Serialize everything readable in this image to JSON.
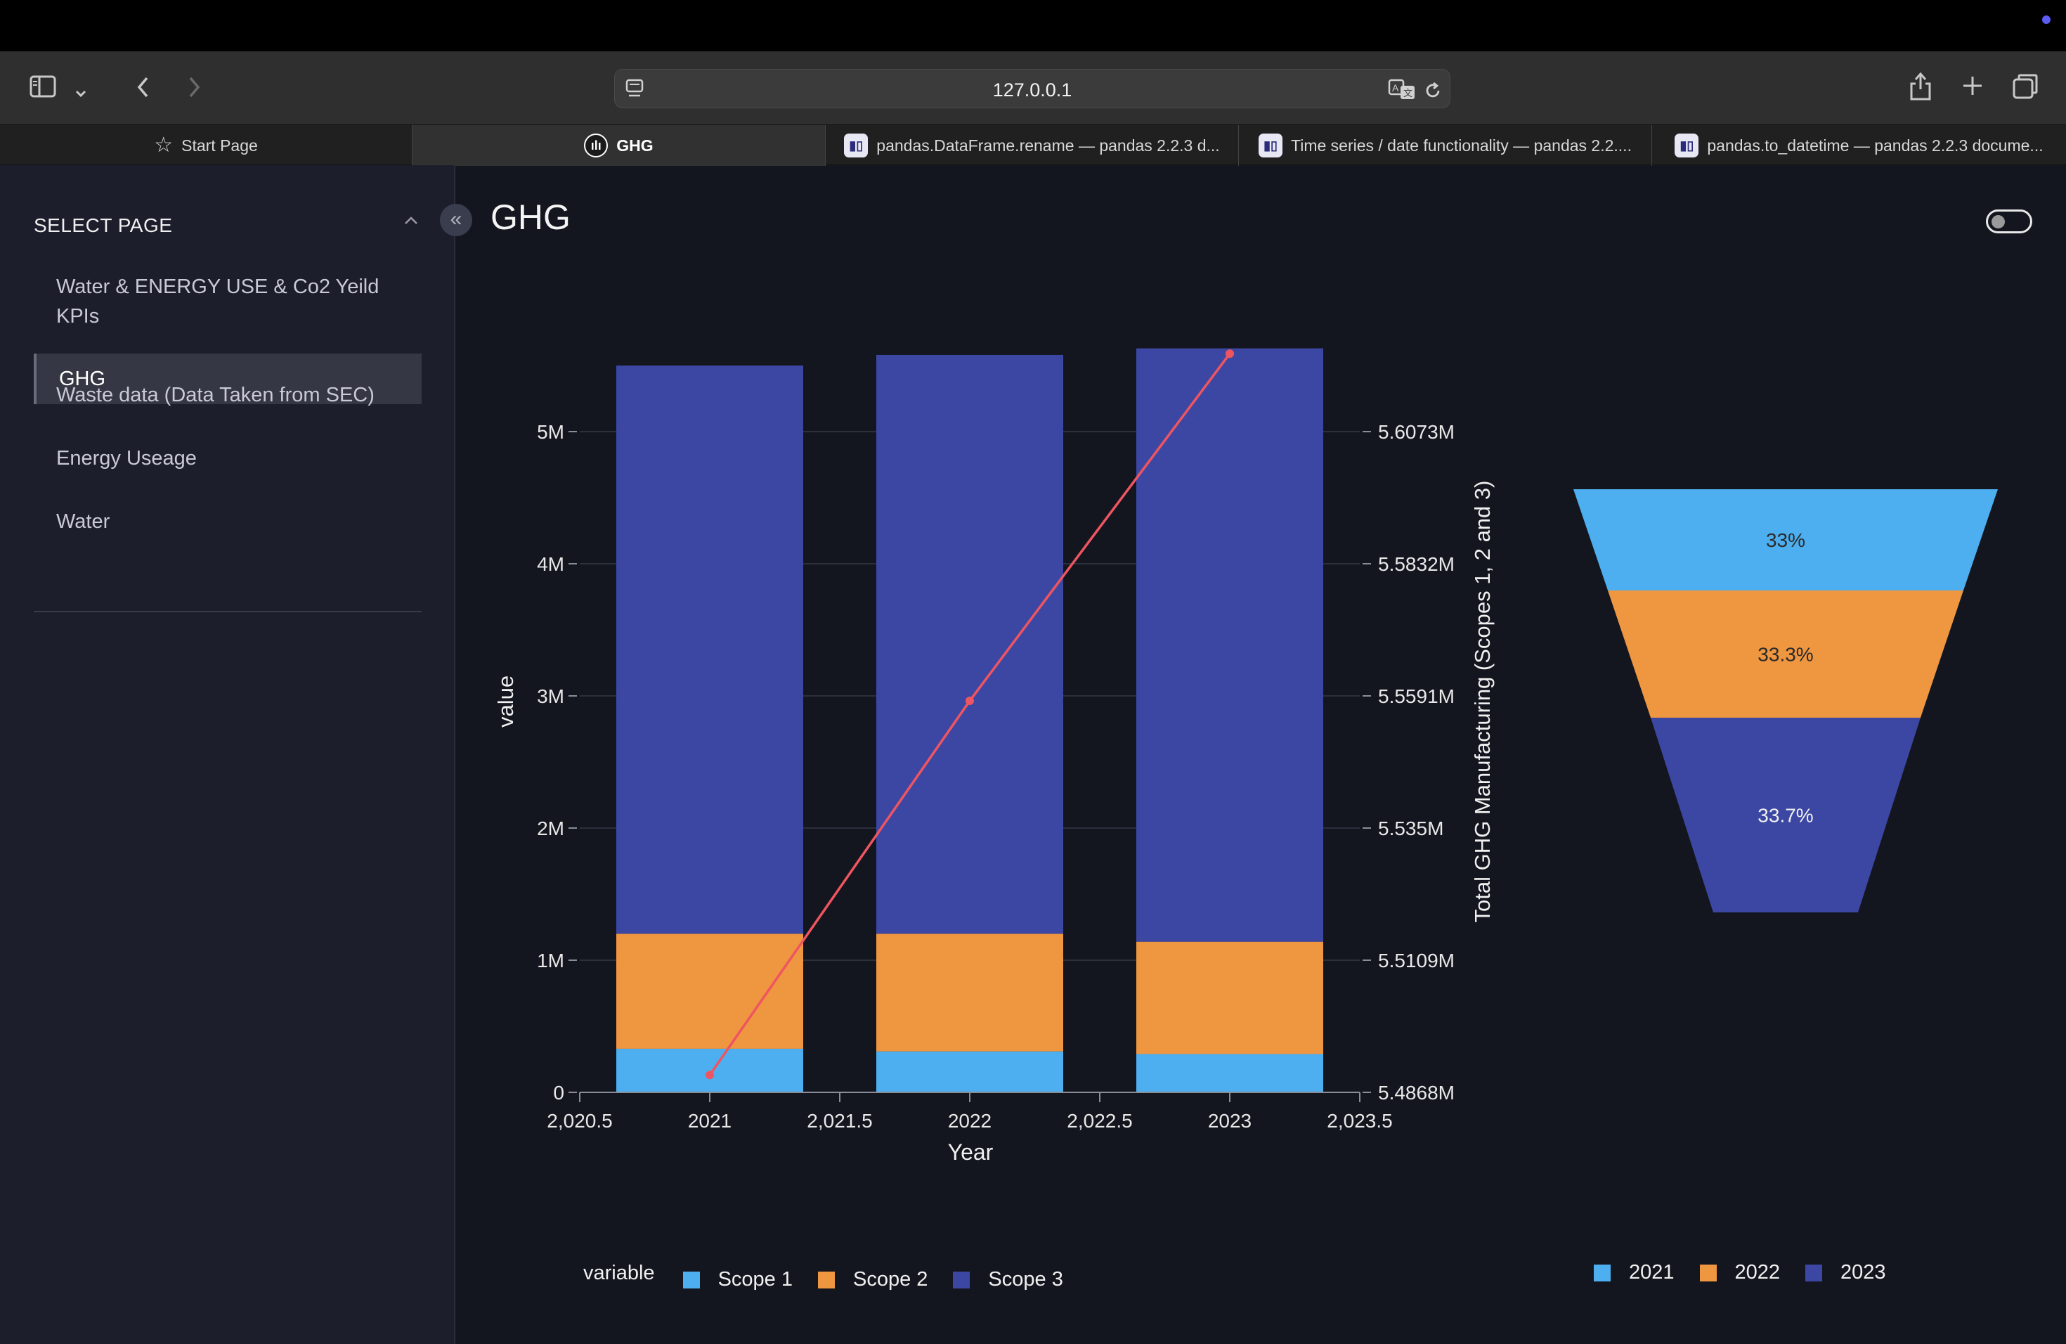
{
  "browser": {
    "url": "127.0.0.1",
    "tabs": [
      {
        "label": "Start Page"
      },
      {
        "label": "GHG"
      },
      {
        "label": "pandas.DataFrame.rename — pandas 2.2.3 d..."
      },
      {
        "label": "Time series / date functionality — pandas 2.2...."
      },
      {
        "label": "pandas.to_datetime — pandas 2.2.3 docume..."
      }
    ]
  },
  "sidebar": {
    "title": "SELECT PAGE",
    "items": [
      {
        "label": "Water & ENERGY USE & Co2 Yeild"
      },
      {
        "label": "KPIs"
      },
      {
        "label": "GHG"
      },
      {
        "label": "Waste data (Data Taken from SEC)"
      },
      {
        "label": "Energy Useage"
      },
      {
        "label": "Water"
      }
    ]
  },
  "page": {
    "title": "GHG"
  },
  "colors": {
    "scope1": "#4dafef",
    "scope2": "#ef9640",
    "scope3": "#3c47a3",
    "line": "#ef5560",
    "background": "#14161f"
  },
  "icons": [
    "sidebar-toggle-icon",
    "chevron-down-icon",
    "back-icon",
    "forward-icon",
    "page-icon",
    "translate-icon",
    "reload-icon",
    "share-icon",
    "plus-icon",
    "tabs-icon",
    "star-icon",
    "chevron-up-icon",
    "double-chevron-left-icon"
  ],
  "chart_data": [
    {
      "type": "bar",
      "stacked": true,
      "categories": [
        2021,
        2022,
        2023
      ],
      "xlabel": "Year",
      "ylabel": "value",
      "x_ticks": [
        "2,020.5",
        "2021",
        "2,021.5",
        "2022",
        "2,022.5",
        "2023",
        "2,023.5"
      ],
      "y_ticks": [
        "0",
        "1M",
        "2M",
        "3M",
        "4M",
        "5M"
      ],
      "ylim": [
        0,
        5600000
      ],
      "legend_title": "variable",
      "series": [
        {
          "name": "Scope 1",
          "values": [
            330000,
            310000,
            290000
          ]
        },
        {
          "name": "Scope 2",
          "values": [
            870000,
            890000,
            850000
          ]
        },
        {
          "name": "Scope 3",
          "values": [
            4300000,
            4380000,
            4490000
          ]
        }
      ],
      "secondary": {
        "type": "line",
        "ylabel": "Total GHG Manufacturing (Scopes 1, 2 and 3)",
        "y_ticks": [
          "5.4868M",
          "5.5109M",
          "5.535M",
          "5.5591M",
          "5.5832M",
          "5.6073M"
        ],
        "ylim": [
          5486800,
          5626000
        ],
        "x": [
          2021,
          2022,
          2023
        ],
        "values": [
          5490000,
          5559000,
          5623000
        ]
      },
      "grid": true
    },
    {
      "type": "funnel",
      "labels": [
        2021,
        2022,
        2023
      ],
      "values": [
        33,
        33.3,
        33.7
      ],
      "text": [
        "33%",
        "33.3%",
        "33.7%"
      ],
      "legend": [
        "2021",
        "2022",
        "2023"
      ]
    }
  ]
}
